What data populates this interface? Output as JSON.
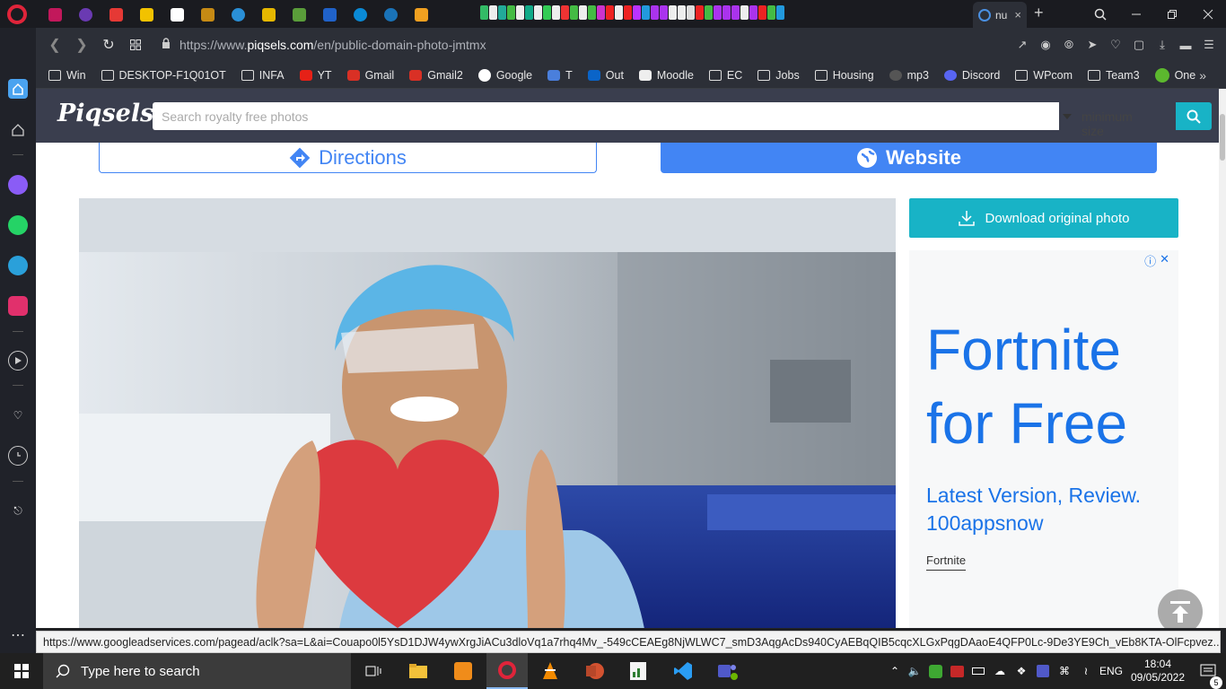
{
  "browser": {
    "active_tab_title": "nu",
    "url_prefix": "https://www.",
    "url_domain": "piqsels.com",
    "url_path": "/en/public-domain-photo-jmtmx",
    "tab_close": "×",
    "new_tab": "+"
  },
  "bookmarks": [
    "Win",
    "DESKTOP-F1Q01OT",
    "INFA",
    "YT",
    "Gmail",
    "Gmail2",
    "Google",
    "T",
    "Out",
    "Moodle",
    "EC",
    "Jobs",
    "Housing",
    "mp3",
    "Discord",
    "WPcom",
    "Team3",
    "One"
  ],
  "site": {
    "logo": "Piqsels",
    "search_placeholder": "Search royalty free photos",
    "min_size": "minimum size"
  },
  "place": {
    "directions": "Directions",
    "website": "Website"
  },
  "download_label": "Download original photo",
  "ad": {
    "title": "Fortnite for Free",
    "subtitle": "Latest Version, Review. 100appsnow",
    "link": "Fortnite"
  },
  "status_url": "https://www.googleadservices.com/pagead/aclk?sa=L&ai=Couapo0l5YsD1DJW4ywXrgJiACu3dloVq1a7rhq4Mv_-549cCEAEg8NjWLWC7_smD3AqgAcDs940CyAEBqQIB5cqcXLGxPqgDAaoE4QFP0Lc-9De3YE9Ch_vEb8KTA-OlFcpvez...",
  "taskbar": {
    "search_placeholder": "Type here to search",
    "lang": "ENG",
    "time": "18:04",
    "date": "09/05/2022",
    "notif_count": "5"
  },
  "colors": {
    "accent_teal": "#18b3c6",
    "google_blue": "#4285f4",
    "header": "#3a3e4e"
  }
}
